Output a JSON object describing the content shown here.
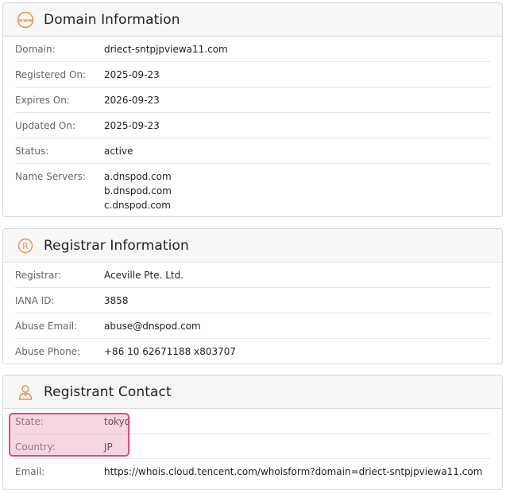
{
  "domain": {
    "title": "Domain Information",
    "rows": [
      {
        "label": "Domain:",
        "value": "driect-sntpjpviewa11.com"
      },
      {
        "label": "Registered On:",
        "value": "2025-09-23"
      },
      {
        "label": "Expires On:",
        "value": "2026-09-23"
      },
      {
        "label": "Updated On:",
        "value": "2025-09-23"
      },
      {
        "label": "Status:",
        "value": "active"
      }
    ],
    "name_servers": {
      "label": "Name Servers:",
      "values": [
        "a.dnspod.com",
        "b.dnspod.com",
        "c.dnspod.com"
      ]
    }
  },
  "registrar": {
    "title": "Registrar Information",
    "rows": [
      {
        "label": "Registrar:",
        "value": "Aceville Pte. Ltd."
      },
      {
        "label": "IANA ID:",
        "value": "3858"
      },
      {
        "label": "Abuse Email:",
        "value": "abuse@dnspod.com"
      },
      {
        "label": "Abuse Phone:",
        "value": "+86 10 62671188 x803707"
      }
    ]
  },
  "registrant": {
    "title": "Registrant Contact",
    "rows": [
      {
        "label": "State:",
        "value": "tokyo"
      },
      {
        "label": "Country:",
        "value": "JP"
      },
      {
        "label": "Email:",
        "value": "https://whois.cloud.tencent.com/whoisform?domain=driect-sntpjpviewa11.com"
      }
    ]
  },
  "colors": {
    "accent": "#f0933f",
    "highlight_border": "#e8467a"
  },
  "icons": {
    "domain": "www-globe-icon",
    "registrar": "registered-icon",
    "registrant": "person-icon"
  }
}
